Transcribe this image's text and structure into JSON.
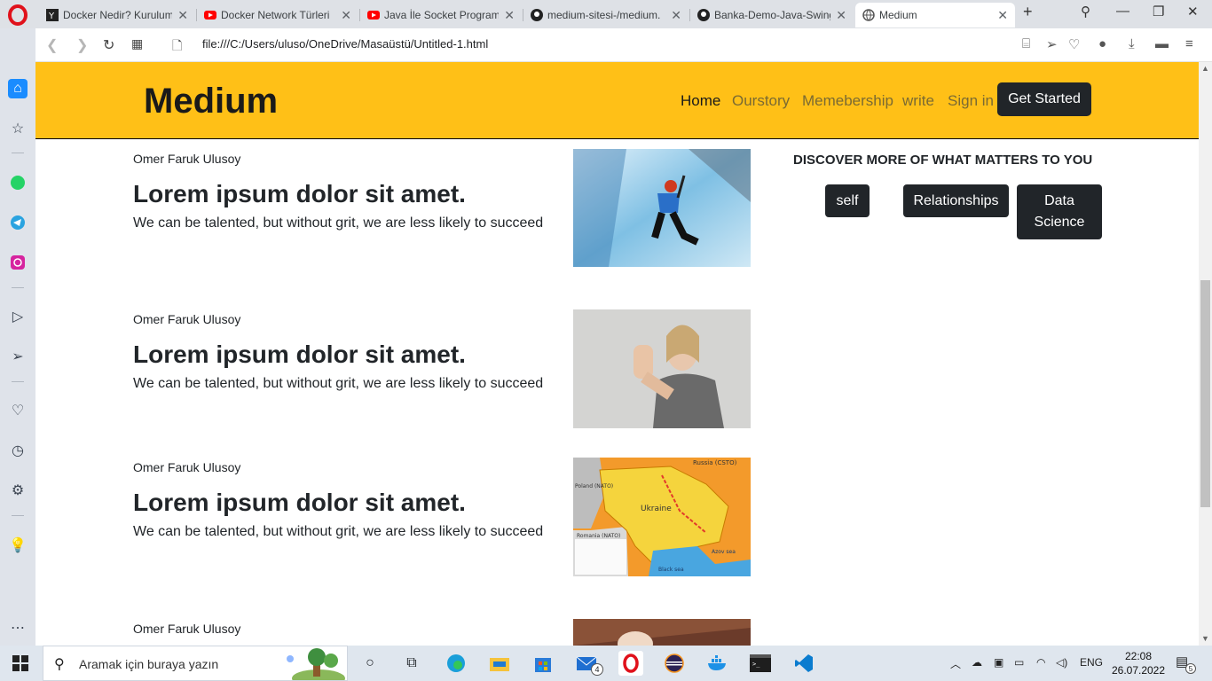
{
  "browser": {
    "tabs": [
      {
        "title": "Docker Nedir? Kurulumu",
        "icon": "yandex-icon"
      },
      {
        "title": "Docker Network Türleri",
        "icon": "youtube-icon"
      },
      {
        "title": "Java İle Socket Programl",
        "icon": "youtube-icon"
      },
      {
        "title": "medium-sitesi-/medium.",
        "icon": "github-icon"
      },
      {
        "title": "Banka-Demo-Java-Swing",
        "icon": "github-icon"
      },
      {
        "title": "Medium",
        "icon": "globe-icon"
      }
    ],
    "url": "file:///C:/Users/uluso/OneDrive/Masaüstü/Untitled-1.html"
  },
  "site": {
    "brand": "Medium",
    "nav": [
      "Home",
      "Ourstory",
      "Memebership",
      "write",
      "Sign in"
    ],
    "cta": "Get Started",
    "accent": "#ffc017"
  },
  "articles": [
    {
      "author": "Omer Faruk Ulusoy",
      "headline": "Lorem ipsum dolor sit amet.",
      "lead": "We can be talented, but without grit, we are less likely to succeed",
      "image": "ice-climber-photo"
    },
    {
      "author": "Omer Faruk Ulusoy",
      "headline": "Lorem ipsum dolor sit amet.",
      "lead": "We can be talented, but without grit, we are less likely to succeed",
      "image": "woman-stop-hand-photo"
    },
    {
      "author": "Omer Faruk Ulusoy",
      "headline": "Lorem ipsum dolor sit amet.",
      "lead": "We can be talented, but without grit, we are less likely to succeed",
      "image": "ukraine-map-image"
    },
    {
      "author": "Omer Faruk Ulusoy",
      "headline": "",
      "lead": "",
      "image": "hand-photo"
    }
  ],
  "map_labels": {
    "country": "Ukraine",
    "russia": "Russia (CSTO)",
    "poland": "Poland (NATO)",
    "romania": "Romania (NATO)",
    "sea": "Black sea",
    "azov": "Azov sea"
  },
  "discover": {
    "title": "DISCOVER MORE OF WHAT MATTERS TO YOU",
    "topics": [
      "self",
      "Relationships",
      "Data Science"
    ]
  },
  "taskbar": {
    "search_placeholder": "Aramak için buraya yazın",
    "language": "ENG",
    "time": "22:08",
    "date": "26.07.2022",
    "mail_badge": "4",
    "notification_count": "5"
  }
}
